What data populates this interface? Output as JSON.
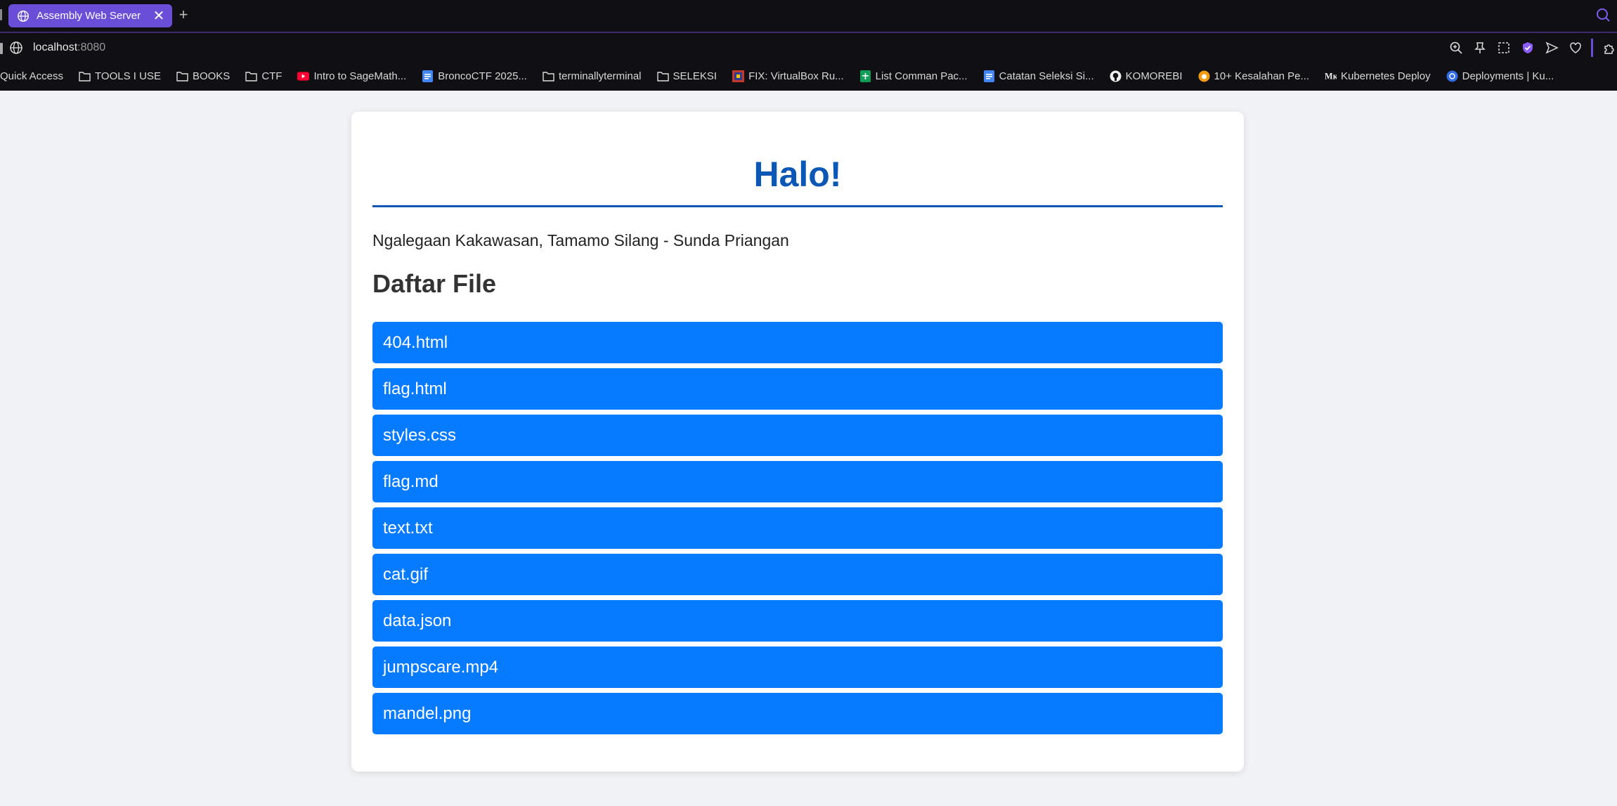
{
  "browser": {
    "tab_title": "Assembly Web Server",
    "url_host": "localhost",
    "url_port": ":8080",
    "bookmarks": [
      {
        "label": "Quick Access",
        "icon": "none"
      },
      {
        "label": "TOOLS I USE",
        "icon": "folder-icon"
      },
      {
        "label": "BOOKS",
        "icon": "folder-icon"
      },
      {
        "label": "CTF",
        "icon": "folder-icon"
      },
      {
        "label": "Intro to SageMath...",
        "icon": "youtube-icon"
      },
      {
        "label": "BroncoCTF 2025...",
        "icon": "docs-icon"
      },
      {
        "label": "terminallyterminal",
        "icon": "folder-icon"
      },
      {
        "label": "SELEKSI",
        "icon": "folder-icon"
      },
      {
        "label": "FIX: VirtualBox Ru...",
        "icon": "site-icon"
      },
      {
        "label": "List Comman Pac...",
        "icon": "sheets-icon"
      },
      {
        "label": "Catatan Seleksi Si...",
        "icon": "docs-icon"
      },
      {
        "label": "KOMOREBI",
        "icon": "github-icon"
      },
      {
        "label": "10+ Kesalahan Pe...",
        "icon": "orange-site-icon"
      },
      {
        "label": "Kubernetes Deploy",
        "icon": "medium-icon"
      },
      {
        "label": "Deployments | Ku...",
        "icon": "kubernetes-icon"
      }
    ]
  },
  "page": {
    "title": "Halo!",
    "subtitle": "Ngalegaan Kakawasan, Tamamo Silang - Sunda Priangan",
    "section_heading": "Daftar File",
    "files": [
      "404.html",
      "flag.html",
      "styles.css",
      "flag.md",
      "text.txt",
      "cat.gif",
      "data.json",
      "jumpscare.mp4",
      "mandel.png"
    ]
  },
  "colors": {
    "tab_active": "#6a4ed8",
    "heading_blue": "#0b57b5",
    "file_button": "#077bff",
    "page_bg": "#f0f2f5"
  }
}
